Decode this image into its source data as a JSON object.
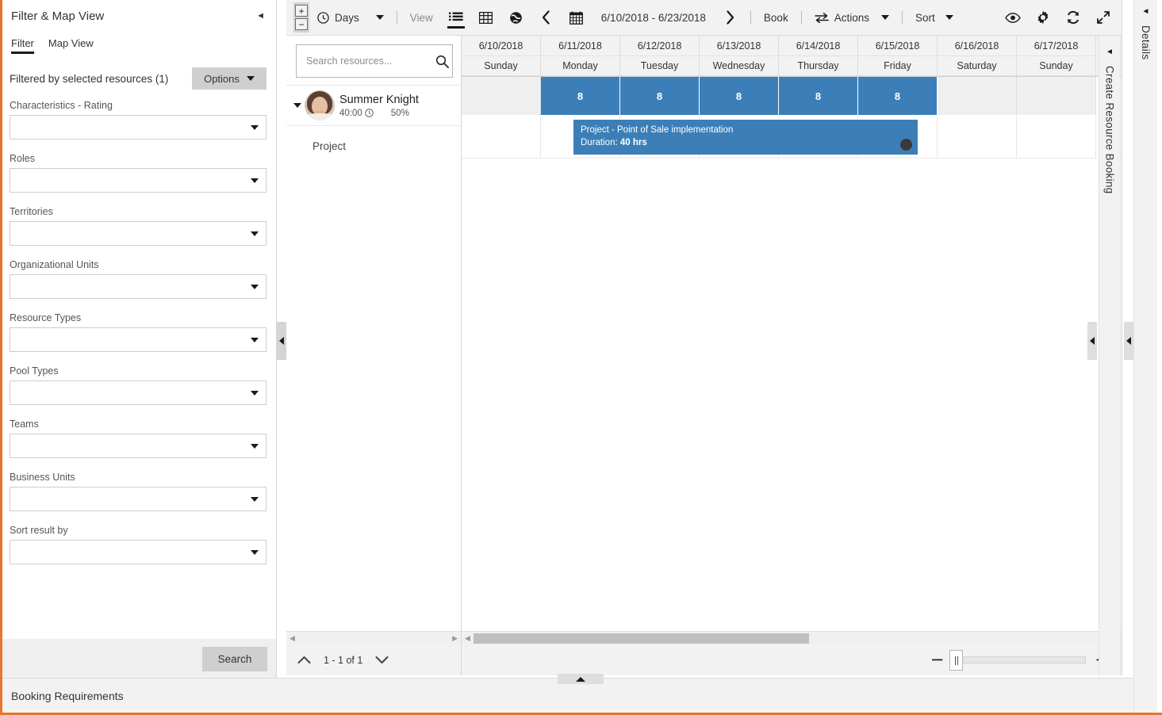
{
  "filter_panel": {
    "title": "Filter & Map View",
    "collapse_icon": "chevron-left-icon",
    "tabs": [
      {
        "label": "Filter",
        "active": true
      },
      {
        "label": "Map View",
        "active": false
      }
    ],
    "filtered_by_label": "Filtered by selected resources (1)",
    "options_label": "Options",
    "fields": [
      {
        "label": "Characteristics - Rating",
        "value": ""
      },
      {
        "label": "Roles",
        "value": ""
      },
      {
        "label": "Territories",
        "value": ""
      },
      {
        "label": "Organizational Units",
        "value": ""
      },
      {
        "label": "Resource Types",
        "value": ""
      },
      {
        "label": "Pool Types",
        "value": ""
      },
      {
        "label": "Teams",
        "value": ""
      },
      {
        "label": "Business Units",
        "value": ""
      },
      {
        "label": "Sort result by",
        "value": ""
      }
    ],
    "search_label": "Search"
  },
  "toolbar": {
    "zoom_in_label": "+",
    "zoom_out_label": "−",
    "scale_label": "Days",
    "view_label": "View",
    "view_modes": [
      {
        "name": "list-view-icon",
        "active": true
      },
      {
        "name": "grid-view-icon",
        "active": false
      },
      {
        "name": "map-view-icon",
        "active": false
      }
    ],
    "prev_label": "‹",
    "next_label": "›",
    "calendar_icon": "calendar-icon",
    "date_range": "6/10/2018 - 6/23/2018",
    "book_label": "Book",
    "actions_label": "Actions",
    "sort_label": "Sort",
    "right_icons": [
      {
        "name": "eye-icon"
      },
      {
        "name": "gear-icon"
      },
      {
        "name": "refresh-icon"
      },
      {
        "name": "expand-icon"
      }
    ]
  },
  "resource_pane": {
    "search_placeholder": "Search resources...",
    "search_value": "",
    "search_icon": "search-icon",
    "resource": {
      "name": "Summer Knight",
      "hours": "40:00",
      "clock_icon": "clock-icon",
      "utilization": "50%"
    },
    "child_row_label": "Project",
    "pager": {
      "up_label": "∧",
      "down_label": "∨",
      "range_text": "1 - 1 of 1"
    }
  },
  "schedule": {
    "columns": [
      {
        "date": "6/10/2018",
        "day": "Sunday",
        "capacity": "",
        "working": false
      },
      {
        "date": "6/11/2018",
        "day": "Monday",
        "capacity": "8",
        "working": true
      },
      {
        "date": "6/12/2018",
        "day": "Tuesday",
        "capacity": "8",
        "working": true
      },
      {
        "date": "6/13/2018",
        "day": "Wednesday",
        "capacity": "8",
        "working": true
      },
      {
        "date": "6/14/2018",
        "day": "Thursday",
        "capacity": "8",
        "working": true
      },
      {
        "date": "6/15/2018",
        "day": "Friday",
        "capacity": "8",
        "working": true
      },
      {
        "date": "6/16/2018",
        "day": "Saturday",
        "capacity": "",
        "working": false
      },
      {
        "date": "6/17/2018",
        "day": "Sunday",
        "capacity": "",
        "working": false
      }
    ],
    "booking": {
      "title": "Project - Point of Sale implementation",
      "duration_label": "Duration:",
      "duration_value": "40 hrs"
    },
    "colors": {
      "booking_blue": "#3c7fb8",
      "capacity_blue": "#3c7fb8",
      "nonworking_gray": "#efefef",
      "accent_orange": "#e8762c"
    }
  },
  "right_panels": {
    "create_resource_booking": "Create Resource Booking",
    "details": "Details"
  },
  "bottom_bar": {
    "label": "Booking Requirements"
  }
}
